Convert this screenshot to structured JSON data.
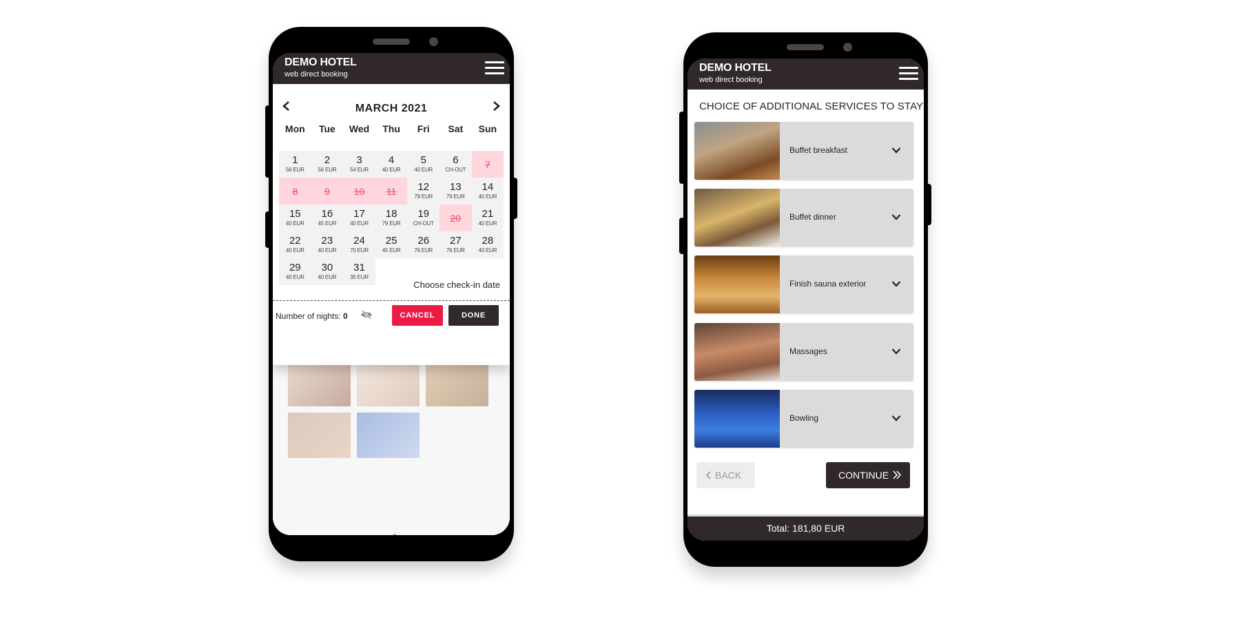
{
  "left_phone": {
    "header": {
      "title": "DEMO HOTEL",
      "subtitle": "web direct booking",
      "menu_icon": "hamburger-icon"
    },
    "calendar": {
      "month_label": "MARCH 2021",
      "prev_icon": "chevron-left-icon",
      "next_icon": "chevron-right-icon",
      "weekdays": [
        "Mon",
        "Tue",
        "Wed",
        "Thu",
        "Fri",
        "Sat",
        "Sun"
      ],
      "days": [
        {
          "day": "1",
          "price": "56 EUR",
          "status": "available"
        },
        {
          "day": "2",
          "price": "56 EUR",
          "status": "available"
        },
        {
          "day": "3",
          "price": "54 EUR",
          "status": "available"
        },
        {
          "day": "4",
          "price": "40 EUR",
          "status": "available"
        },
        {
          "day": "5",
          "price": "40 EUR",
          "status": "available"
        },
        {
          "day": "6",
          "price": "CH-OUT",
          "status": "checkout-only"
        },
        {
          "day": "7",
          "price": "",
          "status": "unavailable"
        },
        {
          "day": "8",
          "price": "",
          "status": "unavailable"
        },
        {
          "day": "9",
          "price": "",
          "status": "unavailable"
        },
        {
          "day": "10",
          "price": "",
          "status": "unavailable"
        },
        {
          "day": "11",
          "price": "",
          "status": "unavailable"
        },
        {
          "day": "12",
          "price": "79 EUR",
          "status": "available"
        },
        {
          "day": "13",
          "price": "79 EUR",
          "status": "available"
        },
        {
          "day": "14",
          "price": "40 EUR",
          "status": "available"
        },
        {
          "day": "15",
          "price": "40 EUR",
          "status": "available"
        },
        {
          "day": "16",
          "price": "45 EUR",
          "status": "available"
        },
        {
          "day": "17",
          "price": "40 EUR",
          "status": "available"
        },
        {
          "day": "18",
          "price": "79 EUR",
          "status": "available"
        },
        {
          "day": "19",
          "price": "CH-OUT",
          "status": "checkout-only"
        },
        {
          "day": "20",
          "price": "",
          "status": "unavailable"
        },
        {
          "day": "21",
          "price": "40 EUR",
          "status": "available"
        },
        {
          "day": "22",
          "price": "40 EUR",
          "status": "available"
        },
        {
          "day": "23",
          "price": "40 EUR",
          "status": "available"
        },
        {
          "day": "24",
          "price": "70 EUR",
          "status": "available"
        },
        {
          "day": "25",
          "price": "45 EUR",
          "status": "available"
        },
        {
          "day": "26",
          "price": "76 EUR",
          "status": "available"
        },
        {
          "day": "27",
          "price": "76 EUR",
          "status": "available"
        },
        {
          "day": "28",
          "price": "40 EUR",
          "status": "available"
        },
        {
          "day": "29",
          "price": "40 EUR",
          "status": "available"
        },
        {
          "day": "30",
          "price": "40 EUR",
          "status": "available"
        },
        {
          "day": "31",
          "price": "35 EUR",
          "status": "available"
        }
      ],
      "hint": "Choose check-in date",
      "nights_label": "Number of nights: ",
      "nights_value": "0",
      "visibility_icon": "eye-off-icon",
      "cancel_label": "CANCEL",
      "done_label": "DONE"
    },
    "gallery": [
      "spa-bath",
      "back-massage",
      "sauna",
      "massage",
      "bowling"
    ]
  },
  "right_phone": {
    "header": {
      "title": "DEMO HOTEL",
      "subtitle": "web direct booking",
      "menu_icon": "hamburger-icon"
    },
    "section_title": "CHOICE OF ADDITIONAL SERVICES TO STAY",
    "services": [
      {
        "label": "Buffet breakfast",
        "image": "buffet-breakfast-image"
      },
      {
        "label": "Buffet dinner",
        "image": "buffet-dinner-image"
      },
      {
        "label": "Finish sauna exterior",
        "image": "sauna-image"
      },
      {
        "label": "Massages",
        "image": "massage-image"
      },
      {
        "label": "Bowling",
        "image": "bowling-image"
      }
    ],
    "back_label": "BACK",
    "continue_label": "CONTINUE",
    "total_label": "Total: 181,80 EUR"
  },
  "colors": {
    "header_bg": "#302829",
    "accent_red": "#ea1c45",
    "blocked_bg": "#ffd6dd",
    "blocked_text": "#ef4d66",
    "card_bg": "#dcdbda"
  }
}
